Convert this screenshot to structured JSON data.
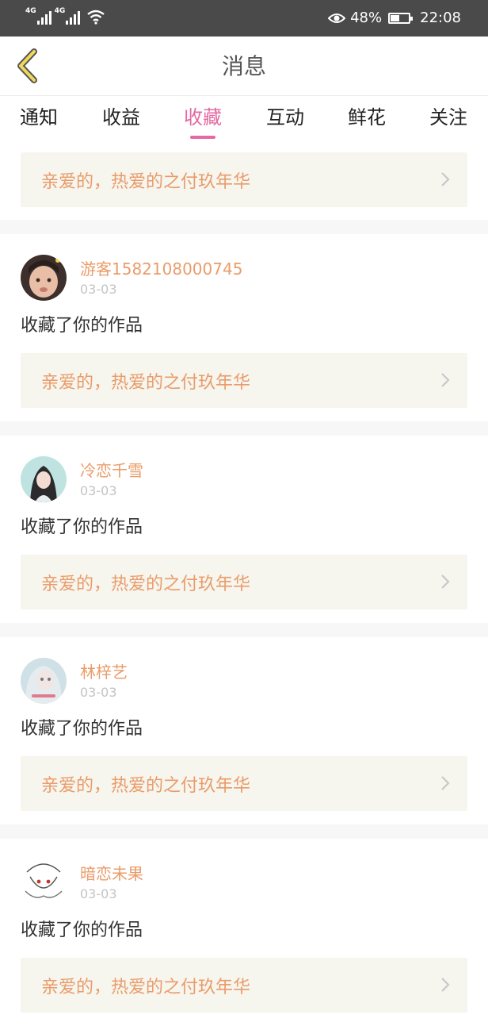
{
  "status_bar": {
    "net1": "4G",
    "net2": "4G",
    "battery_text": "48%",
    "battery_level": 0.48,
    "time": "22:08"
  },
  "header": {
    "title": "消息"
  },
  "tabs": [
    {
      "label": "通知"
    },
    {
      "label": "收益"
    },
    {
      "label": "收藏",
      "active": true
    },
    {
      "label": "互动"
    },
    {
      "label": "鲜花"
    },
    {
      "label": "关注"
    }
  ],
  "top_item": {
    "work_title": "亲爱的，热爱的之付玖年华"
  },
  "items": [
    {
      "user": "游客1582108000745",
      "date": "03-03",
      "action": "收藏了你的作品",
      "work_title": "亲爱的，热爱的之付玖年华"
    },
    {
      "user": "冷恋千雪",
      "date": "03-03",
      "action": "收藏了你的作品",
      "work_title": "亲爱的，热爱的之付玖年华"
    },
    {
      "user": "林梓艺",
      "date": "03-03",
      "action": "收藏了你的作品",
      "work_title": "亲爱的，热爱的之付玖年华"
    },
    {
      "user": "暗恋未果",
      "date": "03-03",
      "action": "收藏了你的作品",
      "work_title": "亲爱的，热爱的之付玖年华"
    }
  ],
  "colors": {
    "accent": "#e56aa4",
    "work_text": "#ea9c6a",
    "work_bg": "#f6f5ee",
    "status_bar": "#4a4a4a",
    "back_icon": "#f0d85a"
  }
}
